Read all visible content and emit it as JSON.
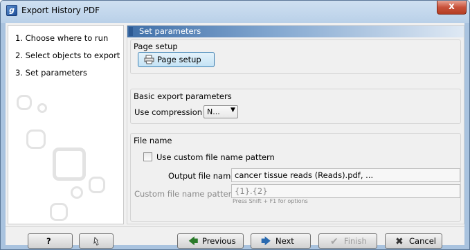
{
  "window": {
    "title": "Export History PDF",
    "app_icon_letter": "g",
    "close_glyph": "x"
  },
  "steps": [
    {
      "number": "1.",
      "label": "Choose where to run"
    },
    {
      "number": "2.",
      "label": "Select objects to export"
    },
    {
      "number": "3.",
      "label": "Set parameters"
    }
  ],
  "panel": {
    "header": "Set parameters",
    "page_setup": {
      "group_title": "Page setup",
      "button_label": "Page setup",
      "icon": "printer-icon"
    },
    "basic_export": {
      "group_title": "Basic export parameters",
      "compression_label": "Use compression",
      "compression_value": "N..."
    },
    "file_name": {
      "group_title": "File name",
      "custom_pattern_checkbox_label": "Use custom file name pattern",
      "custom_pattern_checked": false,
      "output_label": "Output file name",
      "output_value": "cancer tissue reads (Reads).pdf, ...",
      "pattern_label": "Custom file name pattern",
      "pattern_value": "{1}.{2}",
      "pattern_hint": "Press Shift + F1 for options"
    }
  },
  "buttons": {
    "help": "?",
    "reset_icon": "reset-icon",
    "previous": "Previous",
    "next": "Next",
    "finish": "Finish",
    "cancel": "Cancel"
  },
  "colors": {
    "accent": "#3f6fa8",
    "titlebar": "#b9d0e8",
    "close": "#c8523b"
  }
}
